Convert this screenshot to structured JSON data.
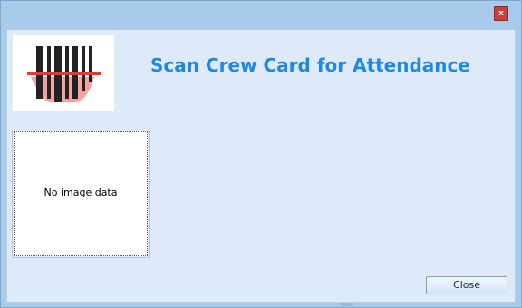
{
  "window": {
    "close_glyph": "x"
  },
  "header": {
    "title": "Scan Crew Card for Attendance",
    "logo_icon": "barcode-scanner-icon"
  },
  "photo": {
    "placeholder_text": "No image data"
  },
  "footer": {
    "close_label": "Close"
  },
  "colors": {
    "accent": "#1e88e5",
    "scan_line": "#e53935"
  }
}
